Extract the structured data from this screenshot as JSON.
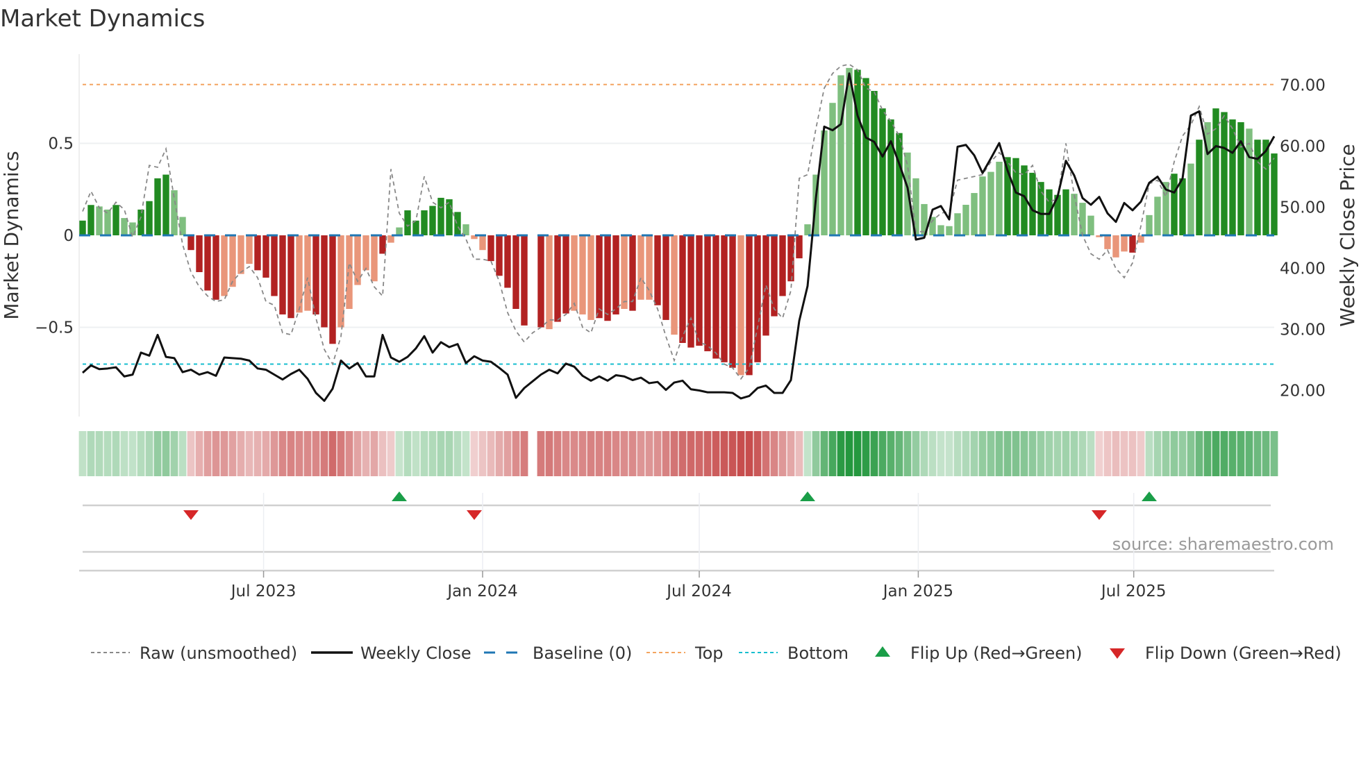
{
  "chart_data": {
    "type": "bar",
    "title": "Market Dynamics",
    "ylabel": "Market Dynamics",
    "y2label": "Weekly Close Price",
    "start_date": "2023-01-30",
    "frequency": "weekly",
    "ylim": [
      -0.98,
      0.98
    ],
    "y2lim": [
      16,
      86
    ],
    "yticks": [
      {
        "v": 0.5,
        "label": "0.5"
      },
      {
        "v": 0,
        "label": "0"
      },
      {
        "v": -0.5,
        "label": "−0.5"
      }
    ],
    "y2ticks": [
      {
        "v": 70,
        "label": "70.00"
      },
      {
        "v": 60,
        "label": "60.00"
      },
      {
        "v": 50,
        "label": "50.00"
      },
      {
        "v": 40,
        "label": "40.00"
      },
      {
        "v": 30,
        "label": "30.00"
      },
      {
        "v": 20,
        "label": "20.00"
      }
    ],
    "xticks": [
      {
        "date": "2023-07-01",
        "label": "Jul 2023"
      },
      {
        "date": "2024-01-01",
        "label": "Jan 2024"
      },
      {
        "date": "2024-07-01",
        "label": "Jul 2024"
      },
      {
        "date": "2025-01-01",
        "label": "Jan 2025"
      },
      {
        "date": "2025-07-01",
        "label": "Jul 2025"
      }
    ],
    "top_threshold": 0.82,
    "bottom_threshold": -0.7,
    "baseline": 0,
    "momentum": [
      0.08,
      0.165,
      0.157,
      0.14,
      0.165,
      0.094,
      0.07,
      0.14,
      0.186,
      0.31,
      0.33,
      0.245,
      0.1,
      -0.08,
      -0.2,
      -0.3,
      -0.35,
      -0.33,
      -0.28,
      -0.21,
      -0.155,
      -0.19,
      -0.23,
      -0.33,
      -0.43,
      -0.45,
      -0.42,
      -0.41,
      -0.43,
      -0.5,
      -0.59,
      -0.5,
      -0.4,
      -0.27,
      -0.19,
      -0.25,
      -0.1,
      -0.04,
      0.043,
      0.136,
      0.08,
      0.136,
      0.16,
      0.204,
      0.196,
      0.127,
      0.06,
      -0.02,
      -0.08,
      -0.14,
      -0.22,
      -0.285,
      -0.4,
      -0.49,
      null,
      -0.5,
      -0.51,
      -0.47,
      -0.425,
      -0.41,
      -0.43,
      -0.46,
      -0.45,
      -0.465,
      -0.43,
      -0.4,
      -0.41,
      -0.35,
      -0.35,
      -0.38,
      -0.46,
      -0.54,
      -0.585,
      -0.61,
      -0.6,
      -0.63,
      -0.67,
      -0.69,
      -0.72,
      -0.76,
      -0.76,
      -0.69,
      -0.545,
      -0.44,
      -0.33,
      -0.25,
      -0.125,
      0.06,
      0.33,
      0.57,
      0.72,
      0.87,
      0.91,
      0.9,
      0.855,
      0.785,
      0.69,
      0.63,
      0.556,
      0.45,
      0.31,
      0.17,
      0.1,
      0.055,
      0.05,
      0.12,
      0.166,
      0.23,
      0.32,
      0.345,
      0.4,
      0.425,
      0.42,
      0.38,
      0.34,
      0.29,
      0.25,
      0.22,
      0.25,
      0.226,
      0.177,
      0.107,
      -0.01,
      -0.075,
      -0.12,
      -0.088,
      -0.094,
      -0.04,
      0.11,
      0.21,
      0.29,
      0.335,
      0.31,
      0.39,
      0.52,
      0.615,
      0.69,
      0.67,
      0.63,
      0.615,
      0.58,
      0.52,
      0.52,
      0.445
    ],
    "shade": "ddlldllddddll",
    "shade_rest": "ddddllllddddd lldddllllldll dddddddlll dd ddddd-ddllldddldllddldddddddldddddddllllll ddddddllllllllll llddddddddllllllldlll l ddldl ddddlddddlllllll",
    "weekly_close": [
      22.9,
      24.1,
      23.5,
      23.6,
      23.8,
      22.3,
      22.6,
      26.2,
      25.7,
      29.1,
      25.5,
      25.3,
      23.0,
      23.4,
      22.6,
      23.0,
      22.4,
      25.4,
      25.3,
      25.2,
      24.9,
      23.6,
      23.4,
      22.6,
      21.8,
      22.7,
      23.4,
      21.9,
      19.6,
      18.3,
      20.3,
      24.9,
      23.6,
      24.5,
      22.3,
      22.3,
      29.1,
      25.4,
      24.7,
      25.5,
      26.9,
      28.9,
      26.2,
      27.9,
      27.1,
      27.6,
      24.5,
      25.6,
      24.9,
      24.7,
      23.7,
      22.6,
      18.8,
      20.4,
      21.5,
      22.6,
      23.4,
      22.8,
      24.4,
      23.9,
      22.4,
      21.6,
      22.3,
      21.6,
      22.5,
      22.3,
      21.7,
      22.1,
      21.2,
      21.4,
      20.1,
      21.3,
      21.6,
      20.2,
      20.0,
      19.7,
      19.7,
      19.7,
      19.6,
      18.7,
      19.1,
      20.4,
      20.8,
      19.6,
      19.6,
      21.7,
      31.4,
      37.1,
      51.5,
      63.2,
      62.6,
      63.6,
      71.9,
      65.0,
      61.4,
      60.7,
      58.3,
      60.8,
      57.1,
      53.2,
      44.7,
      45.0,
      49.6,
      50.2,
      48.0,
      59.9,
      60.2,
      58.5,
      55.6,
      58.0,
      60.5,
      56.0,
      52.4,
      51.8,
      49.5,
      48.9,
      48.9,
      51.7,
      57.6,
      55.2,
      51.5,
      50.4,
      51.7,
      49.0,
      47.6,
      50.7,
      49.5,
      50.9,
      54.0,
      55.0,
      52.9,
      52.4,
      54.7,
      65.0,
      65.7,
      58.7,
      60.0,
      59.7,
      58.9,
      60.8,
      58.2,
      57.9,
      59.2,
      61.6
    ],
    "raw": [
      0.13,
      0.24,
      0.15,
      0.12,
      0.18,
      0.14,
      -0.01,
      0.1,
      0.38,
      0.37,
      0.47,
      0.2,
      -0.05,
      -0.2,
      -0.28,
      -0.33,
      -0.36,
      -0.35,
      -0.25,
      -0.2,
      -0.17,
      -0.23,
      -0.36,
      -0.38,
      -0.53,
      -0.54,
      -0.4,
      -0.23,
      -0.45,
      -0.62,
      -0.7,
      -0.55,
      -0.15,
      -0.25,
      -0.18,
      -0.28,
      -0.33,
      0.36,
      0.12,
      0.05,
      0.08,
      0.32,
      0.18,
      0.15,
      0.18,
      0.05,
      -0.02,
      -0.13,
      -0.13,
      -0.14,
      -0.25,
      -0.42,
      -0.52,
      -0.58,
      -0.53,
      -0.5,
      -0.46,
      -0.46,
      -0.43,
      -0.37,
      -0.5,
      -0.53,
      -0.4,
      -0.43,
      -0.4,
      -0.36,
      -0.36,
      -0.23,
      -0.3,
      -0.4,
      -0.55,
      -0.68,
      -0.55,
      -0.45,
      -0.58,
      -0.6,
      -0.64,
      -0.7,
      -0.72,
      -0.78,
      -0.72,
      -0.5,
      -0.27,
      -0.4,
      -0.45,
      -0.3,
      0.31,
      0.33,
      0.58,
      0.8,
      0.88,
      0.92,
      0.93,
      0.9,
      0.8,
      0.78,
      0.68,
      0.62,
      0.54,
      0.38,
      0.02,
      0.02,
      0.08,
      0.12,
      0.13,
      0.3,
      0.31,
      0.32,
      0.33,
      0.4,
      0.45,
      0.4,
      0.34,
      0.33,
      0.38,
      0.24,
      0.18,
      0.2,
      0.5,
      0.22,
      0.0,
      -0.1,
      -0.13,
      -0.08,
      -0.18,
      -0.23,
      -0.15,
      0.05,
      0.28,
      0.3,
      0.21,
      0.4,
      0.54,
      0.6,
      0.7,
      0.55,
      0.58,
      0.65,
      0.58,
      0.48,
      0.5,
      0.4,
      0.36,
      0.42
    ],
    "legend": [
      {
        "key": "raw",
        "label": "Raw (unsmoothed)"
      },
      {
        "key": "close",
        "label": "Weekly Close"
      },
      {
        "key": "baseline",
        "label": "Baseline (0)"
      },
      {
        "key": "top",
        "label": "Top"
      },
      {
        "key": "bottom",
        "label": "Bottom"
      },
      {
        "key": "flip_up",
        "label": "Flip Up (Red→Green)"
      },
      {
        "key": "flip_down",
        "label": "Flip Down (Green→Red)"
      }
    ],
    "legend_position": "bottom",
    "source": "source: sharemaestro.com",
    "colors": {
      "pos_dark": "#228b22",
      "pos_light": "#7fbf7f",
      "neg_dark": "#b22222",
      "neg_light": "#e9967a",
      "baseline": "#1f77b4",
      "top": "#f4a460",
      "bottom": "#17becf",
      "flip_up": "#1a9e48",
      "flip_down": "#d62728",
      "close": "#111111",
      "raw": "#888888"
    }
  }
}
